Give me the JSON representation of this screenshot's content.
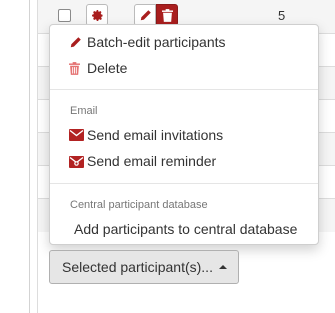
{
  "table": {
    "rows": [
      {
        "id": "5"
      },
      {
        "id": ""
      },
      {
        "id": ""
      },
      {
        "id": ""
      },
      {
        "id": ""
      },
      {
        "id": ""
      },
      {
        "id": ""
      }
    ]
  },
  "dropdown": {
    "items_top": [
      {
        "label": "Batch-edit participants",
        "icon": "pencil-icon"
      },
      {
        "label": "Delete",
        "icon": "trash-icon"
      }
    ],
    "email_header": "Email",
    "email_items": [
      {
        "label": "Send email invitations",
        "icon": "envelope-icon"
      },
      {
        "label": "Send email reminder",
        "icon": "envelope-reminder-icon"
      }
    ],
    "central_header": "Central participant database",
    "central_items": [
      {
        "label": "Add participants to central database"
      }
    ]
  },
  "selected_button": {
    "label": "Selected participant(s)..."
  },
  "colors": {
    "danger": "#a91e1e",
    "delete_icon": "#e57373",
    "accent_red": "#b22222"
  }
}
